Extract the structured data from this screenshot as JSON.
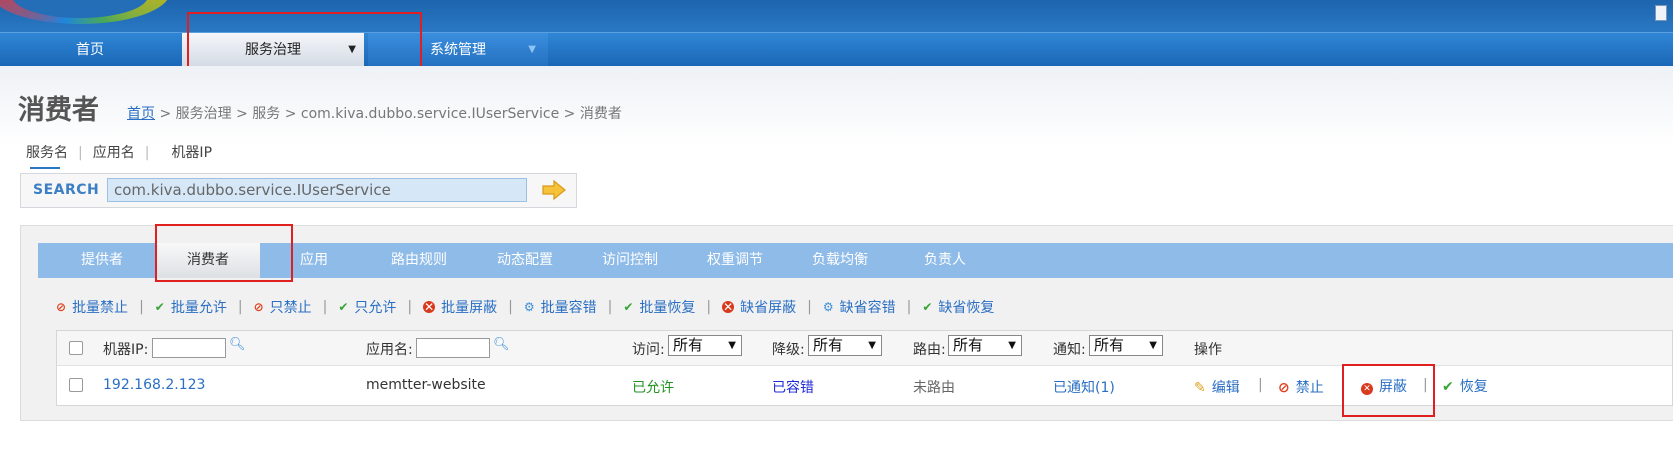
{
  "nav": {
    "home": "首页",
    "service_governance": "服务治理",
    "system_management": "系统管理",
    "caret": "▼"
  },
  "page": {
    "title": "消费者",
    "breadcrumb": {
      "home": "首页",
      "rest": " > 服务治理 > 服务 > com.kiva.dubbo.service.IUserService > 消费者"
    }
  },
  "search": {
    "tabs": [
      "服务名",
      "应用名",
      "机器IP"
    ],
    "label": "SEARCH",
    "value": "com.kiva.dubbo.service.IUserService"
  },
  "tabs": [
    "提供者",
    "消费者",
    "应用",
    "路由规则",
    "动态配置",
    "访问控制",
    "权重调节",
    "负载均衡",
    "负责人"
  ],
  "actions": [
    "批量禁止",
    "批量允许",
    "只禁止",
    "只允许",
    "批量屏蔽",
    "批量容错",
    "批量恢复",
    "缺省屏蔽",
    "缺省容错",
    "缺省恢复"
  ],
  "table": {
    "headers": {
      "ip": "机器IP:",
      "app": "应用名:",
      "access": "访问:",
      "degrade": "降级:",
      "route": "路由:",
      "notify": "通知:",
      "ops": "操作"
    },
    "filter_option": "所有",
    "rows": [
      {
        "ip": "192.168.2.123",
        "app": "memtter-website",
        "access": "已允许",
        "degrade": "已容错",
        "route": "未路由",
        "notify": "已通知(1)",
        "ops": [
          "编辑",
          "禁止",
          "屏蔽",
          "恢复"
        ]
      }
    ]
  },
  "colors": {
    "nav_blue": "#1a66b6",
    "tab_blue": "#8ebbe8",
    "link": "#2a6fc4",
    "highlight_red": "#e02020",
    "allowed_green": "#229322",
    "tolerant_blue": "#1d2ad8"
  },
  "icons": {
    "search_go": "arrow-right-icon",
    "ban": "ban-icon",
    "check": "check-icon",
    "shield": "x-circle-icon",
    "gear": "gear-icon",
    "edit": "pencil-icon",
    "magnifier": "search-icon"
  }
}
